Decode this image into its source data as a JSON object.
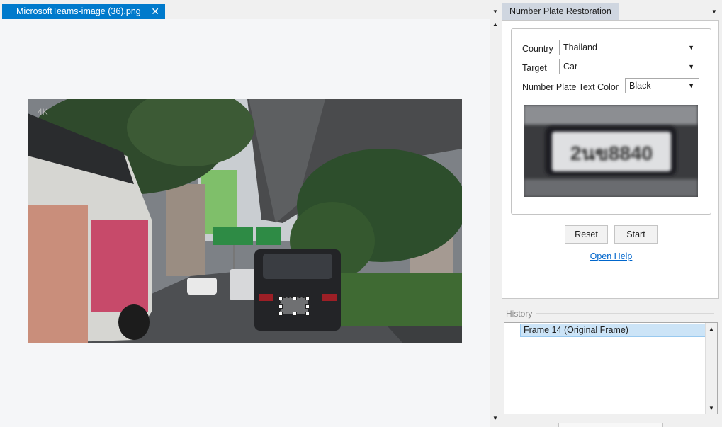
{
  "document": {
    "tab_title": "MicrosoftTeams-image (36).png",
    "close_glyph": "✕",
    "photo_watermark": "4K"
  },
  "panel": {
    "tab_title": "Number Plate Restoration",
    "country": {
      "label": "Country",
      "value": "Thailand"
    },
    "target": {
      "label": "Target",
      "value": "Car"
    },
    "text_color": {
      "label": "Number Plate Text Color",
      "value": "Black"
    },
    "preview_plate_text": "2นข8840",
    "reset_label": "Reset",
    "start_label": "Start",
    "help_link": "Open Help"
  },
  "history": {
    "label": "History",
    "items": [
      "Frame 14 (Original Frame)"
    ]
  },
  "icons": {
    "dropdown": "chevron-down-icon",
    "scroll_up": "scroll-up-icon",
    "scroll_down": "scroll-down-icon",
    "close": "close-icon"
  },
  "colors": {
    "accent": "#007acc",
    "panel_tab": "#cfd6e0",
    "selection": "#cce4f7",
    "link": "#0066cc"
  }
}
